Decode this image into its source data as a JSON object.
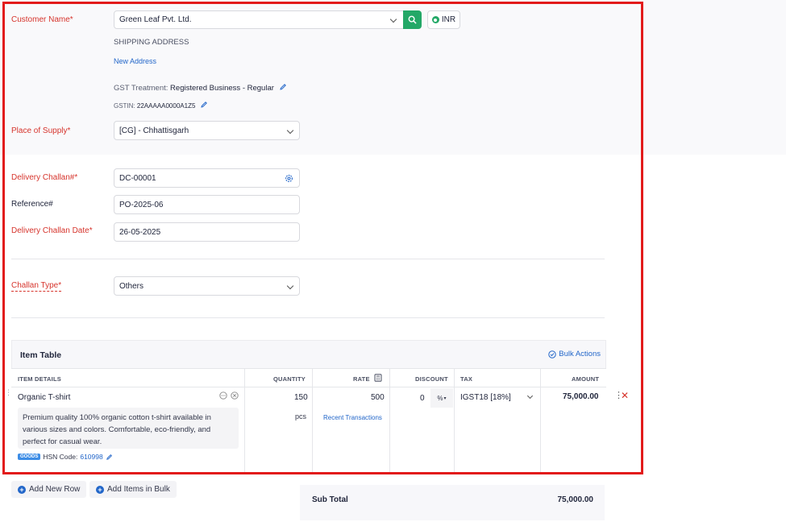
{
  "form": {
    "customer_name_label": "Customer Name*",
    "customer_name_value": "Green Leaf Pvt. Ltd.",
    "currency": "INR",
    "shipping_address_heading": "SHIPPING ADDRESS",
    "new_address_link": "New Address",
    "gst_treatment_label": "GST Treatment:",
    "gst_treatment_value": "Registered Business - Regular",
    "gstin_label": "GSTIN:",
    "gstin_value": "22AAAAA0000A1Z5",
    "place_of_supply_label": "Place of Supply*",
    "place_of_supply_value": "[CG] - Chhattisgarh",
    "delivery_challan_label": "Delivery Challan#*",
    "delivery_challan_value": "DC-00001",
    "reference_label": "Reference#",
    "reference_value": "PO-2025-06",
    "challan_date_label": "Delivery Challan Date*",
    "challan_date_value": "26-05-2025",
    "challan_type_label": "Challan Type*",
    "challan_type_value": "Others"
  },
  "item_table": {
    "title": "Item Table",
    "bulk_actions": "Bulk Actions",
    "columns": [
      "ITEM DETAILS",
      "QUANTITY",
      "RATE",
      "DISCOUNT",
      "TAX",
      "AMOUNT"
    ],
    "rows": [
      {
        "name": "Organic T-shirt",
        "description": "Premium quality 100% organic cotton t-shirt available in various sizes and colors. Comfortable, eco-friendly, and perfect for casual wear.",
        "desc_line1": "Premium quality 100% organic cotton t-shirt available in",
        "desc_line2": "various sizes and colors. Comfortable, eco-friendly, and",
        "desc_line3": "perfect for casual wear.",
        "type_badge": "GOODS",
        "hsn_label": "HSN Code:",
        "hsn_value": "610998",
        "quantity": "150",
        "unit": "pcs",
        "rate": "500",
        "recent_transactions": "Recent Transactions",
        "discount": "0",
        "discount_type": "%",
        "tax": "IGST18 [18%]",
        "amount": "75,000.00"
      }
    ]
  },
  "actions": {
    "add_new_row": "Add New Row",
    "add_items_bulk": "Add Items in Bulk"
  },
  "totals": {
    "sub_total_label": "Sub Total",
    "sub_total_value": "75,000.00"
  },
  "colors": {
    "accent_green": "#23a867",
    "link_blue": "#2266c9",
    "required_red": "#d6342c",
    "frame_red": "#e21b1b"
  }
}
